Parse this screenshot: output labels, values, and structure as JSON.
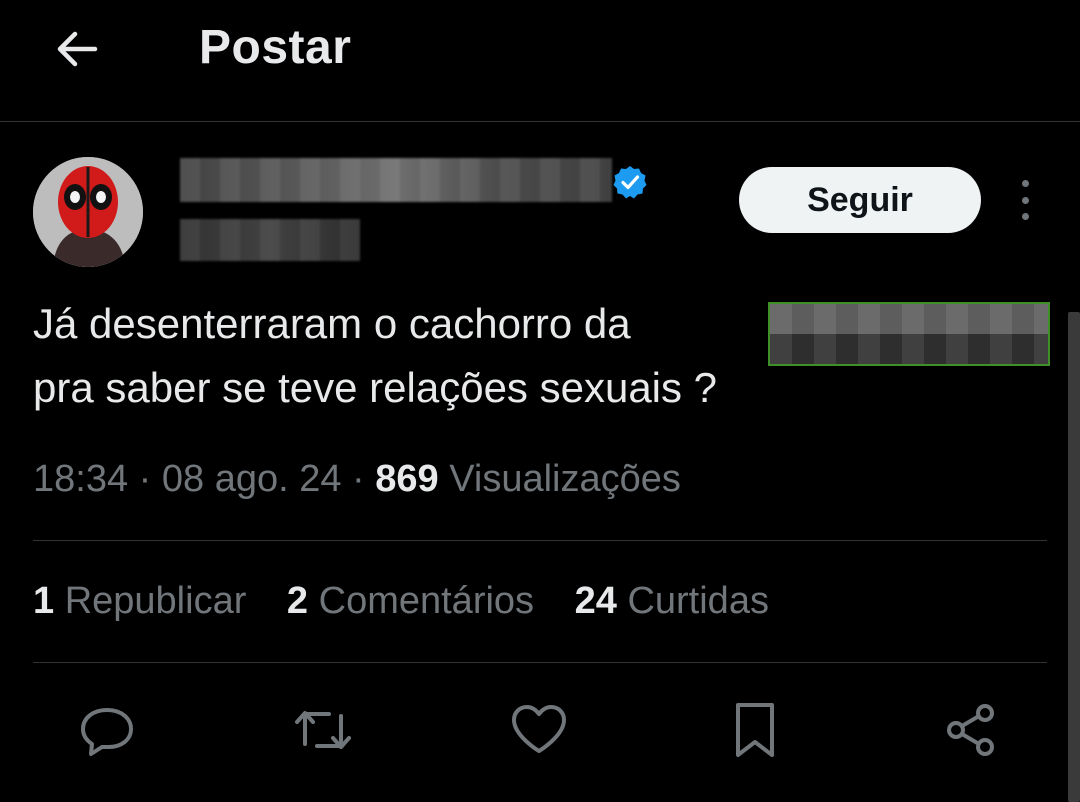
{
  "header": {
    "back_icon": "arrow-left-icon",
    "title": "Postar"
  },
  "author": {
    "verified_color": "#1d9bf0",
    "follow_label": "Seguir",
    "more_icon": "more-vertical-icon"
  },
  "tweet": {
    "text_line1": "Já desenterraram o cachorro da",
    "text_line2": "pra saber se teve relações sexuais ?"
  },
  "meta": {
    "time": "18:34",
    "date": "08 ago. 24",
    "views_count": "869",
    "views_label": "Visualizações"
  },
  "stats": {
    "reposts_count": "1",
    "reposts_label": "Republicar",
    "comments_count": "2",
    "comments_label": "Comentários",
    "likes_count": "24",
    "likes_label": "Curtidas"
  },
  "actions": {
    "reply_icon": "reply-icon",
    "repost_icon": "repost-icon",
    "like_icon": "heart-icon",
    "bookmark_icon": "bookmark-icon",
    "share_icon": "share-icon"
  },
  "colors": {
    "background": "#000000",
    "text_primary": "#e7e9ea",
    "text_secondary": "#71767b",
    "divider": "#2f3336",
    "verified": "#1d9bf0"
  }
}
